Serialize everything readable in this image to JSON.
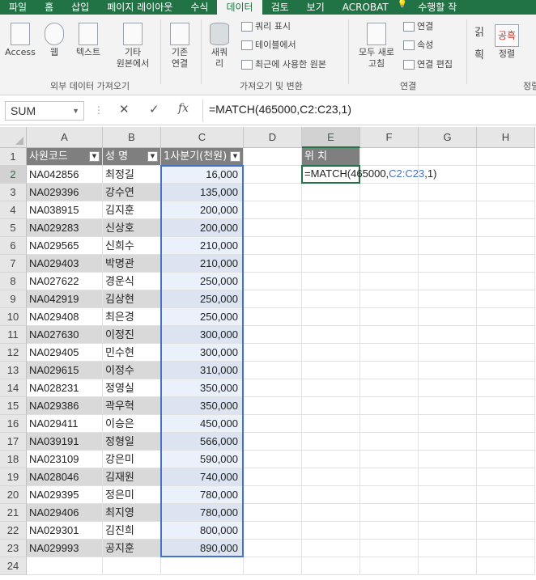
{
  "tabs": [
    "파일",
    "홈",
    "삽입",
    "페이지 레이아웃",
    "수식",
    "데이터",
    "검토",
    "보기",
    "ACROBAT",
    "수행할 작"
  ],
  "active_tab": "데이터",
  "tellme_icon": "lightbulb-icon",
  "ribbon": {
    "access": "Access",
    "web": "웹",
    "text": "텍스트",
    "other_line1": "기타",
    "other_line2": "원본에서",
    "existing_line1": "기존",
    "existing_line2": "연결",
    "group_external": "외부 데이터 가져오기",
    "newquery_line1": "새쿼",
    "newquery_line2": "리",
    "show_query": "쿼리 표시",
    "from_table": "테이블에서",
    "recent_sources": "최근에 사용한 원본",
    "group_transform": "가져오기 및 변환",
    "refresh_line1": "모두 새로",
    "refresh_line2": "고침",
    "connections": "연결",
    "properties": "속성",
    "edit_links": "연결 편집",
    "group_connections": "연결",
    "sort_asc": "긹",
    "sort_glyph": "공흑",
    "sort_desc": "흭",
    "sort": "정렬",
    "group_sort": "정렬"
  },
  "formula_bar": {
    "name_box": "SUM",
    "cancel_glyph": "✕",
    "enter_glyph": "✓",
    "fx_glyph": "fx",
    "formula": "=MATCH(465000,C2:C23,1)"
  },
  "columns": [
    "A",
    "B",
    "C",
    "D",
    "E",
    "F",
    "G",
    "H"
  ],
  "row_numbers": [
    "1",
    "2",
    "3",
    "4",
    "5",
    "6",
    "7",
    "8",
    "9",
    "10",
    "11",
    "12",
    "13",
    "14",
    "15",
    "16",
    "17",
    "18",
    "19",
    "20",
    "21",
    "22",
    "23",
    "24"
  ],
  "headers": {
    "emp_code": "사원코드",
    "name": "성  명",
    "q1": "1사분기(천원)",
    "position": "위 치"
  },
  "rows": [
    {
      "code": "NA042856",
      "name": "최정길",
      "value": "16,000"
    },
    {
      "code": "NA029396",
      "name": "강수연",
      "value": "135,000"
    },
    {
      "code": "NA038915",
      "name": "김지훈",
      "value": "200,000"
    },
    {
      "code": "NA029283",
      "name": "신상호",
      "value": "200,000"
    },
    {
      "code": "NA029565",
      "name": "신희수",
      "value": "210,000"
    },
    {
      "code": "NA029403",
      "name": "박명관",
      "value": "210,000"
    },
    {
      "code": "NA027622",
      "name": "경운식",
      "value": "250,000"
    },
    {
      "code": "NA042919",
      "name": "김상현",
      "value": "250,000"
    },
    {
      "code": "NA029408",
      "name": "최은경",
      "value": "250,000"
    },
    {
      "code": "NA027630",
      "name": "이정진",
      "value": "300,000"
    },
    {
      "code": "NA029405",
      "name": "민수현",
      "value": "300,000"
    },
    {
      "code": "NA029615",
      "name": "이정수",
      "value": "310,000"
    },
    {
      "code": "NA028231",
      "name": "정영실",
      "value": "350,000"
    },
    {
      "code": "NA029386",
      "name": "곽우혁",
      "value": "350,000"
    },
    {
      "code": "NA029411",
      "name": "이승은",
      "value": "450,000"
    },
    {
      "code": "NA039191",
      "name": "정형일",
      "value": "566,000"
    },
    {
      "code": "NA023109",
      "name": "강은미",
      "value": "590,000"
    },
    {
      "code": "NA028046",
      "name": "김재원",
      "value": "740,000"
    },
    {
      "code": "NA029395",
      "name": "정은미",
      "value": "780,000"
    },
    {
      "code": "NA029406",
      "name": "최지영",
      "value": "780,000"
    },
    {
      "code": "NA029301",
      "name": "김진희",
      "value": "800,000"
    },
    {
      "code": "NA029993",
      "name": "공지훈",
      "value": "890,000"
    }
  ],
  "active_cell": {
    "prefix": "=MATCH(465000,",
    "range_ref": "C2:C23",
    "suffix": ",1)"
  },
  "colors": {
    "excel_green": "#217346",
    "header_gray": "#7f7f7f",
    "range_blue": "#4472c4"
  }
}
